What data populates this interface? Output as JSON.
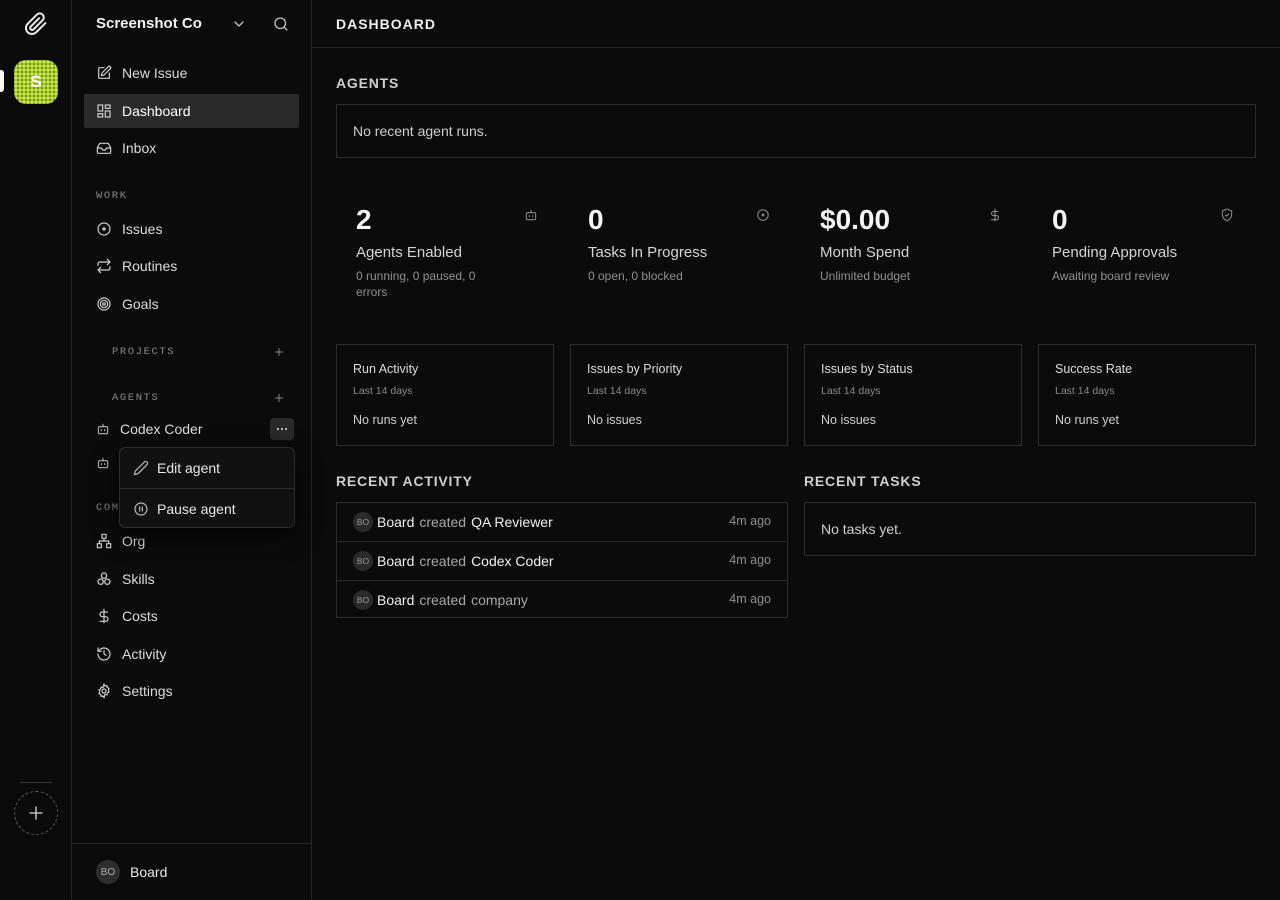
{
  "rail": {
    "company_initial": "S",
    "company_avatar_color": "#a9cc2a"
  },
  "sidebar": {
    "company_name": "Screenshot Co",
    "primary": [
      {
        "label": "New Issue",
        "icon": "edit-icon"
      },
      {
        "label": "Dashboard",
        "icon": "dashboard-icon",
        "active": true
      },
      {
        "label": "Inbox",
        "icon": "inbox-icon"
      }
    ],
    "work_label": "WORK",
    "work": [
      {
        "label": "Issues",
        "icon": "circle-dot-icon"
      },
      {
        "label": "Routines",
        "icon": "repeat-icon"
      },
      {
        "label": "Goals",
        "icon": "target-icon"
      }
    ],
    "projects_label": "PROJECTS",
    "agents_label": "AGENTS",
    "agents": [
      {
        "label": "Codex Coder",
        "icon": "bot-icon"
      },
      {
        "label": "",
        "icon": "bot-icon"
      }
    ],
    "company_label_partial": "COMP",
    "company": [
      {
        "label": "Org",
        "icon": "org-icon"
      },
      {
        "label": "Skills",
        "icon": "skills-icon"
      },
      {
        "label": "Costs",
        "icon": "dollar-icon"
      },
      {
        "label": "Activity",
        "icon": "history-icon"
      },
      {
        "label": "Settings",
        "icon": "gear-icon"
      }
    ],
    "footer": {
      "initials": "BO",
      "name": "Board"
    }
  },
  "agent_menu": {
    "edit_label": "Edit agent",
    "pause_label": "Pause agent"
  },
  "main": {
    "page_title": "DASHBOARD",
    "agents_heading": "AGENTS",
    "agents_empty": "No recent agent runs.",
    "stats": [
      {
        "value": "2",
        "label": "Agents Enabled",
        "sub": "0 running, 0 paused, 0 errors",
        "icon": "bot-icon"
      },
      {
        "value": "0",
        "label": "Tasks In Progress",
        "sub": "0 open, 0 blocked",
        "icon": "circle-dot-icon"
      },
      {
        "value": "$0.00",
        "label": "Month Spend",
        "sub": "Unlimited budget",
        "icon": "dollar-icon"
      },
      {
        "value": "0",
        "label": "Pending Approvals",
        "sub": "Awaiting board review",
        "icon": "shield-check-icon"
      }
    ],
    "mini_cards": [
      {
        "title": "Run Activity",
        "sub": "Last 14 days",
        "empty": "No runs yet"
      },
      {
        "title": "Issues by Priority",
        "sub": "Last 14 days",
        "empty": "No issues"
      },
      {
        "title": "Issues by Status",
        "sub": "Last 14 days",
        "empty": "No issues"
      },
      {
        "title": "Success Rate",
        "sub": "Last 14 days",
        "empty": "No runs yet"
      }
    ],
    "recent_activity_heading": "RECENT ACTIVITY",
    "recent_activity": [
      {
        "initials": "BO",
        "actor": "Board",
        "verb": "created",
        "target": "QA Reviewer",
        "time": "4m ago"
      },
      {
        "initials": "BO",
        "actor": "Board",
        "verb": "created",
        "target": "Codex Coder",
        "time": "4m ago"
      },
      {
        "initials": "BO",
        "actor": "Board",
        "verb": "created",
        "target": "company",
        "time": "4m ago"
      }
    ],
    "recent_tasks_heading": "RECENT TASKS",
    "recent_tasks_empty": "No tasks yet."
  }
}
